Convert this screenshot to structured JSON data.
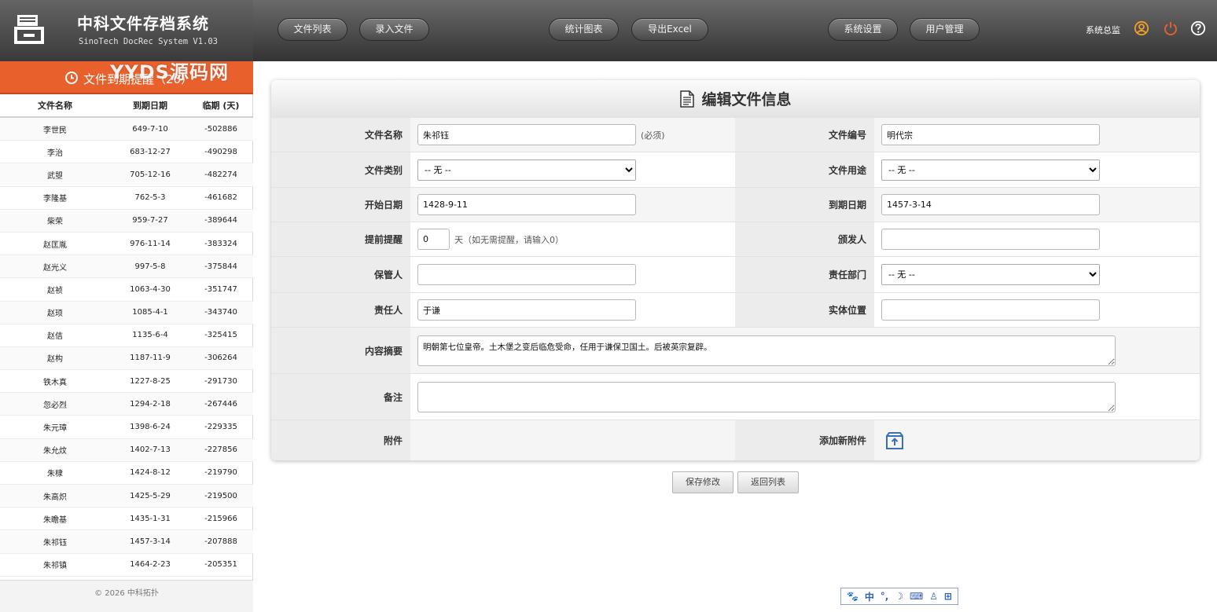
{
  "app": {
    "title": "中科文件存档系统",
    "subtitle": "SinoTech DocRec System V1.03",
    "watermark": "YYDS源码网"
  },
  "nav": {
    "file_list": "文件列表",
    "add_file": "录入文件",
    "stats": "统计图表",
    "export": "导出Excel",
    "settings": "系统设置",
    "users": "用户管理",
    "user_name": "系统总监"
  },
  "reminder": {
    "title": "文件到期提醒（20）",
    "headers": [
      "文件名称",
      "到期日期",
      "临期 (天)"
    ],
    "items": [
      {
        "name": "李世民",
        "date": "649-7-10",
        "days": "-502886"
      },
      {
        "name": "李治",
        "date": "683-12-27",
        "days": "-490298"
      },
      {
        "name": "武曌",
        "date": "705-12-16",
        "days": "-482274"
      },
      {
        "name": "李隆基",
        "date": "762-5-3",
        "days": "-461682"
      },
      {
        "name": "柴荣",
        "date": "959-7-27",
        "days": "-389644"
      },
      {
        "name": "赵匡胤",
        "date": "976-11-14",
        "days": "-383324"
      },
      {
        "name": "赵光义",
        "date": "997-5-8",
        "days": "-375844"
      },
      {
        "name": "赵祯",
        "date": "1063-4-30",
        "days": "-351747"
      },
      {
        "name": "赵顼",
        "date": "1085-4-1",
        "days": "-343740"
      },
      {
        "name": "赵佶",
        "date": "1135-6-4",
        "days": "-325415"
      },
      {
        "name": "赵构",
        "date": "1187-11-9",
        "days": "-306264"
      },
      {
        "name": "铁木真",
        "date": "1227-8-25",
        "days": "-291730"
      },
      {
        "name": "忽必烈",
        "date": "1294-2-18",
        "days": "-267446"
      },
      {
        "name": "朱元璋",
        "date": "1398-6-24",
        "days": "-229335"
      },
      {
        "name": "朱允炆",
        "date": "1402-7-13",
        "days": "-227856"
      },
      {
        "name": "朱棣",
        "date": "1424-8-12",
        "days": "-219790"
      },
      {
        "name": "朱高炽",
        "date": "1425-5-29",
        "days": "-219500"
      },
      {
        "name": "朱瞻基",
        "date": "1435-1-31",
        "days": "-215966"
      },
      {
        "name": "朱祁钰",
        "date": "1457-3-14",
        "days": "-207888"
      },
      {
        "name": "朱祁镇",
        "date": "1464-2-23",
        "days": "-205351"
      }
    ],
    "copyright": "© 2026 中科拓扑"
  },
  "form": {
    "title": "编辑文件信息",
    "labels": {
      "name": "文件名称",
      "number": "文件编号",
      "category": "文件类别",
      "purpose": "文件用途",
      "start": "开始日期",
      "due": "到期日期",
      "remind": "提前提醒",
      "issuer": "颁发人",
      "keeper": "保管人",
      "dept": "责任部门",
      "owner": "责任人",
      "location": "实体位置",
      "summary": "内容摘要",
      "note": "备注",
      "attach": "附件",
      "add_attach": "添加新附件"
    },
    "values": {
      "name": "朱祁钰",
      "number": "明代宗",
      "category": "-- 无 --",
      "purpose": "-- 无 --",
      "start": "1428-9-11",
      "due": "1457-3-14",
      "remind": "0",
      "issuer": "",
      "keeper": "",
      "dept": "-- 无 --",
      "owner": "于谦",
      "location": "",
      "summary": "明朝第七位皇帝。土木堡之变后临危受命，任用于谦保卫国土。后被英宗复辟。",
      "note": ""
    },
    "hints": {
      "required": "(必须)",
      "remind": "天（如无需提醒，请输入0）"
    },
    "save": "保存修改",
    "back": "返回列表"
  },
  "ime": {
    "chinese": "中"
  },
  "colors": {
    "accent": "#e8612c",
    "attach_icon": "#3a6fb5"
  }
}
